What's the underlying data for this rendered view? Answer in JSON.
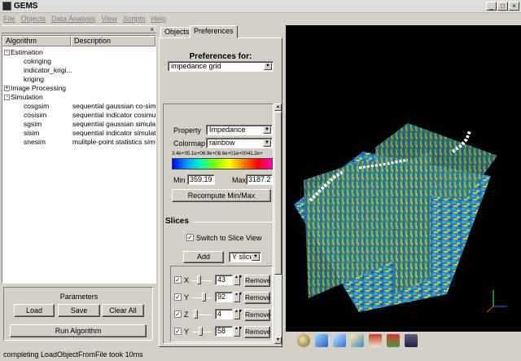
{
  "window": {
    "title": "GEMS"
  },
  "menu": [
    "File",
    "Objects",
    "Data Analysis",
    "View",
    "Scripts",
    "Help"
  ],
  "algo_table": {
    "headers": [
      "Algorithm",
      "Description"
    ],
    "rows": [
      {
        "name": "Estimation",
        "desc": "",
        "level": 0,
        "expander": "-"
      },
      {
        "name": "cokriging",
        "desc": "",
        "level": 1,
        "expander": ""
      },
      {
        "name": "indicator_krigi...",
        "desc": "",
        "level": 1,
        "expander": ""
      },
      {
        "name": "kriging",
        "desc": "",
        "level": 1,
        "expander": ""
      },
      {
        "name": "Image Processing",
        "desc": "",
        "level": 0,
        "expander": "+"
      },
      {
        "name": "Simulation",
        "desc": "",
        "level": 0,
        "expander": "-"
      },
      {
        "name": "cosgsim",
        "desc": "sequential gaussian co-simu",
        "level": 1,
        "expander": ""
      },
      {
        "name": "cosisim",
        "desc": "sequential indicator cosimul",
        "level": 1,
        "expander": ""
      },
      {
        "name": "sgsim",
        "desc": "sequential gaussian simulat",
        "level": 1,
        "expander": ""
      },
      {
        "name": "sisim",
        "desc": "sequential indicator simulati",
        "level": 1,
        "expander": ""
      },
      {
        "name": "snesim",
        "desc": "mulitple-point statistics simu",
        "level": 1,
        "expander": ""
      }
    ]
  },
  "params": {
    "title": "Parameters",
    "load": "Load",
    "save": "Save",
    "clear": "Clear All",
    "run": "Run Algorithm"
  },
  "status": "completing LoadObjectFromFile took 10ms",
  "tabs": {
    "objects": "Objects",
    "preferences": "Preferences"
  },
  "prefs": {
    "header": "Preferences for:",
    "object": "impedance grid",
    "property_label": "Property",
    "property": "Impedance",
    "colormap_label": "Colormap",
    "colormap": "rainbow",
    "colorbar_ticks": "3.4e+05.1e+06.9e+08.6e+01e+0041.2e+",
    "min_label": "Min",
    "min": "359.19",
    "max_label": "Max",
    "max": "3187.2",
    "recompute": "Recompute Min/Max"
  },
  "slices": {
    "title": "Slices",
    "switch_label": "Switch to Slice View",
    "add": "Add",
    "add_type": "Y slice",
    "remove": "Remove",
    "items": [
      {
        "axis": "X",
        "value": "43",
        "level": 0.3
      },
      {
        "axis": "Y",
        "value": "92",
        "level": 0.62
      },
      {
        "axis": "Z",
        "value": "4",
        "level": 0.08
      },
      {
        "axis": "Y",
        "value": "58",
        "level": 0.4
      }
    ]
  },
  "colors": {
    "background": "#d4d0c8",
    "view_bg": "#000000",
    "accent": "#0a246a"
  }
}
